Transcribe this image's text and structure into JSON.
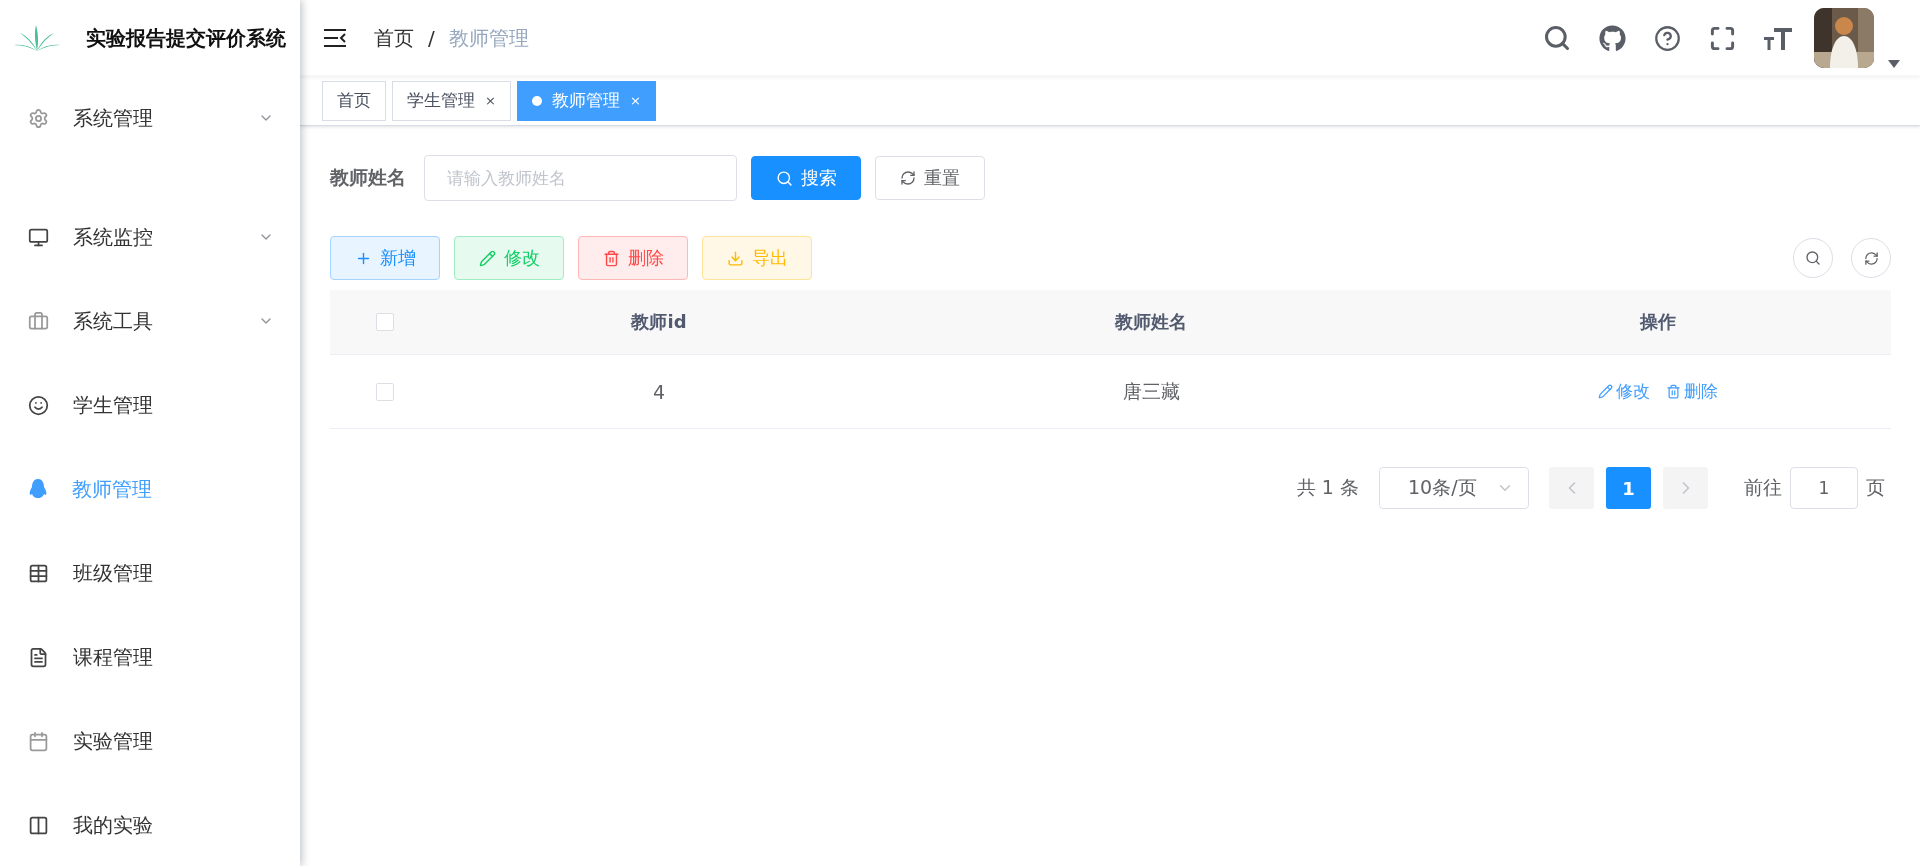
{
  "app": {
    "title": "实验报告提交评价系统"
  },
  "sidebar": {
    "items": [
      {
        "label": "系统管理",
        "expandable": true,
        "selected": false
      },
      {
        "label": "系统监控",
        "expandable": true,
        "selected": false
      },
      {
        "label": "系统工具",
        "expandable": true,
        "selected": false
      },
      {
        "label": "学生管理",
        "expandable": false,
        "selected": false
      },
      {
        "label": "教师管理",
        "expandable": false,
        "selected": true
      },
      {
        "label": "班级管理",
        "expandable": false,
        "selected": false
      },
      {
        "label": "课程管理",
        "expandable": false,
        "selected": false
      },
      {
        "label": "实验管理",
        "expandable": false,
        "selected": false
      },
      {
        "label": "我的实验",
        "expandable": false,
        "selected": false
      }
    ]
  },
  "breadcrumb": [
    {
      "label": "首页",
      "current": false
    },
    {
      "label": "/",
      "current": false
    },
    {
      "label": "教师管理",
      "current": true
    }
  ],
  "tags": [
    {
      "label": "首页",
      "closable": false,
      "selected": false
    },
    {
      "label": "学生管理",
      "closable": true,
      "selected": false
    },
    {
      "label": "教师管理",
      "closable": true,
      "selected": true
    }
  ],
  "close_glyph": "×",
  "search": {
    "label": "教师姓名",
    "placeholder": "请输入教师姓名",
    "search_button": "搜索",
    "reset_button": "重置"
  },
  "toolbar": [
    {
      "label": "新增",
      "kind": "add"
    },
    {
      "label": "修改",
      "kind": "edit"
    },
    {
      "label": "删除",
      "kind": "delete"
    },
    {
      "label": "导出",
      "kind": "export"
    }
  ],
  "table": {
    "columns": [
      "教师id",
      "教师姓名",
      "操作"
    ],
    "header_checked": false,
    "rows": [
      {
        "checked": false,
        "id": "4",
        "name": "唐三藏",
        "actions": [
          "修改",
          "删除"
        ]
      }
    ]
  },
  "pagination": {
    "total": "共 1 条",
    "page_size": "10条/页",
    "pages": [
      {
        "label": "1",
        "selected": true
      }
    ],
    "goto_label": "前往",
    "goto_value": "1",
    "page_suffix": "页"
  }
}
